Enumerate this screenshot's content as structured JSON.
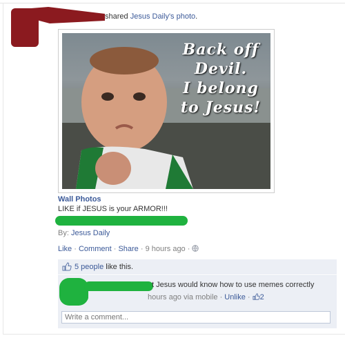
{
  "story": {
    "verb": "shared",
    "owner_link": "Jesus Daily's",
    "object_link": "photo",
    "end": "."
  },
  "photo": {
    "meme_lines": [
      "Back off",
      "Devil.",
      "I belong",
      "to Jesus!"
    ]
  },
  "post": {
    "album_title": "Wall Photos",
    "caption": "LIKE if JESUS is your ARMOR!!!",
    "by_label": "By:",
    "by_name": "Jesus Daily"
  },
  "actions": {
    "like": "Like",
    "comment": "Comment",
    "share": "Share",
    "time": "9 hours ago",
    "sep": " · "
  },
  "likes": {
    "count_link": "5 people",
    "suffix": " like this."
  },
  "comment": {
    "text": "t Jesus would know how to use memes correctly",
    "time": "hours ago via mobile",
    "unlike": "Unlike",
    "like_count": "2"
  },
  "comment_input": {
    "placeholder": "Write a comment..."
  },
  "colors": {
    "link": "#3b5998",
    "redact_red": "#8b1a1f",
    "redact_green": "#1fb23f",
    "ufi_bg": "#eceff5"
  },
  "icons": {
    "privacy": "globe-icon",
    "like": "thumbs-up-icon"
  }
}
